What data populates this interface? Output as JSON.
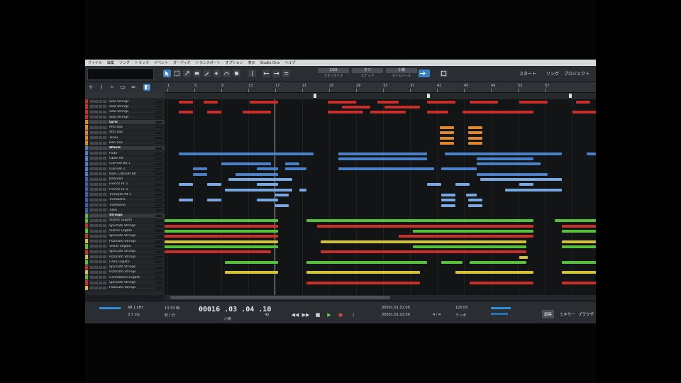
{
  "menu": [
    "ファイル",
    "編集",
    "ソング",
    "トラック",
    "イベント",
    "オーディオ",
    "トランスポート",
    "オプション",
    "表示",
    "Studio One",
    "ヘルプ"
  ],
  "toolbar": {
    "quantize": [
      {
        "value": "1/16",
        "label": "クオンタイズ"
      },
      {
        "value": "オフ",
        "label": "スナップ"
      },
      {
        "value": "小節",
        "label": "タイムベース"
      }
    ],
    "nav": [
      "スタート",
      "ソング",
      "プロジェクト"
    ]
  },
  "ruler": [
    "1",
    "5",
    "9",
    "13",
    "17",
    "21",
    "25",
    "29",
    "33",
    "37",
    "41",
    "45",
    "49",
    "53",
    "57"
  ],
  "tracks": [
    {
      "name": "Solo Strings",
      "color": "#c9302c",
      "folder": false
    },
    {
      "name": "Solo Strings",
      "color": "#c9302c",
      "folder": false
    },
    {
      "name": "Solo Strings",
      "color": "#c9302c",
      "folder": false
    },
    {
      "name": "Solo Strings",
      "color": "#c9302c",
      "folder": false
    },
    {
      "name": "Lyric",
      "color": "#e0872a",
      "folder": true
    },
    {
      "name": "Alto Sax",
      "color": "#e0872a",
      "folder": false
    },
    {
      "name": "Alto Sax",
      "color": "#e0872a",
      "folder": false
    },
    {
      "name": "Tenor",
      "color": "#e0872a",
      "folder": false
    },
    {
      "name": "Bari Sax",
      "color": "#e0872a",
      "folder": false
    },
    {
      "name": "Winds",
      "color": "#4b7fc8",
      "folder": true
    },
    {
      "name": "Flute",
      "color": "#4b7fc8",
      "folder": false
    },
    {
      "name": "Oboe Alt",
      "color": "#4b7fc8",
      "folder": false
    },
    {
      "name": "Clarinet Bb 1",
      "color": "#4b7fc8",
      "folder": false
    },
    {
      "name": "Clarinet 2",
      "color": "#4b7fc8",
      "folder": false
    },
    {
      "name": "Bass Clarinet Bb",
      "color": "#4b7fc8",
      "folder": false
    },
    {
      "name": "Bassoon",
      "color": "#3a5fb0",
      "folder": false
    },
    {
      "name": "French Hr 1",
      "color": "#3a5fb0",
      "folder": false
    },
    {
      "name": "French Hr 2",
      "color": "#3a5fb0",
      "folder": false
    },
    {
      "name": "Trumpet Alt 1",
      "color": "#3a5fb0",
      "folder": false
    },
    {
      "name": "Trombone",
      "color": "#3a5fb0",
      "folder": false
    },
    {
      "name": "Trombone",
      "color": "#3a5fb0",
      "folder": false
    },
    {
      "name": "Tuba",
      "color": "#3a5fb0",
      "folder": false
    },
    {
      "name": "Strings",
      "color": "#57c03a",
      "folder": true
    },
    {
      "name": "Violins Legato",
      "color": "#57c03a",
      "folder": false
    },
    {
      "name": "Spiccato Strings",
      "color": "#c9302c",
      "folder": false
    },
    {
      "name": "Violins Legato",
      "color": "#57c03a",
      "folder": false
    },
    {
      "name": "Spiccato Strings",
      "color": "#c9302c",
      "folder": false
    },
    {
      "name": "Pizzicato Strings",
      "color": "#d3c332",
      "folder": false
    },
    {
      "name": "Violas Legato",
      "color": "#57c03a",
      "folder": false
    },
    {
      "name": "Spiccato Strings",
      "color": "#c9302c",
      "folder": false
    },
    {
      "name": "Pizzicato Strings",
      "color": "#d3c332",
      "folder": false
    },
    {
      "name": "Cello Legato",
      "color": "#57c03a",
      "folder": false
    },
    {
      "name": "Spiccato Strings",
      "color": "#c9302c",
      "folder": false
    },
    {
      "name": "Pizzicato Strings",
      "color": "#d3c332",
      "folder": false
    },
    {
      "name": "Contrabass Legato",
      "color": "#57c03a",
      "folder": false
    },
    {
      "name": "Spiccato Strings",
      "color": "#c9302c",
      "folder": false
    },
    {
      "name": "Pizzicato Strings",
      "color": "#d3c332",
      "folder": false
    }
  ],
  "transport": {
    "samplerate": "48.1 kHz",
    "latency": "3.7 ms",
    "time": "13:33 時",
    "timelabel": "秒 / 分",
    "position": "00016 .03 .04 .10",
    "position_unit": "小節",
    "loop_l": "00001.01.01.00",
    "loop_r": "00001.01.01.00",
    "tempo": "120.00",
    "tempo_label": "テンポ",
    "signature": "4 / 4",
    "tabs": [
      "編集",
      "ミキサー",
      "ブラウザ"
    ]
  }
}
